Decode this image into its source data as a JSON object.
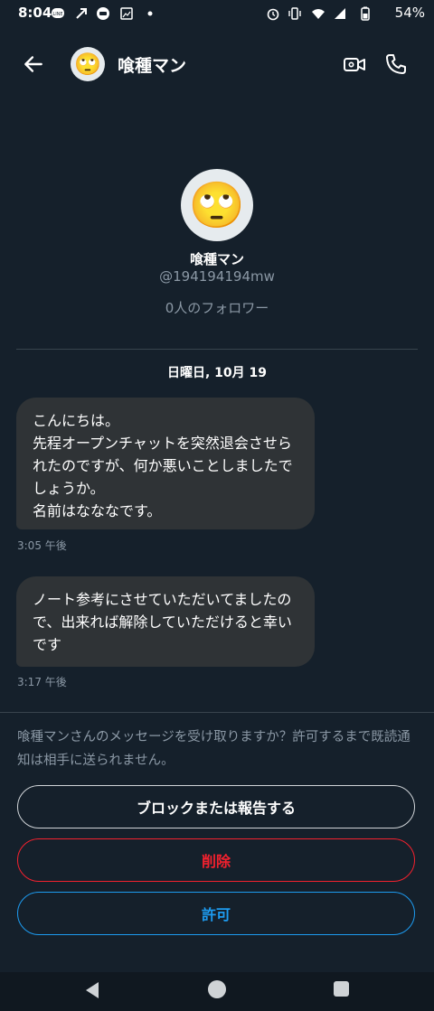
{
  "status_bar": {
    "time": "8:04",
    "battery": "54%",
    "icons": [
      "line-icon",
      "arrow-icon",
      "podcast-icon",
      "gallery-icon",
      "dot-icon",
      "alarm-icon",
      "vibrate-icon",
      "wifi-icon",
      "signal-icon",
      "battery-icon"
    ]
  },
  "header": {
    "name": "喰種マン",
    "avatar_emoji": "🙄"
  },
  "profile": {
    "avatar_emoji": "🙄",
    "name": "喰種マン",
    "handle": "@194194194mw",
    "followers": "0人のフォロワー"
  },
  "conversation": {
    "date": "日曜日, 10月 19",
    "messages": [
      {
        "text": "こんにちは。\n先程オープンチャットを突然退会させられたのですが、何か悪いことしましたでしょうか。\n名前はなななです。",
        "time": "3:05 午後"
      },
      {
        "text": "ノート参考にさせていただいてましたので、出来れば解除していただけると幸いです",
        "time": "3:17 午後"
      }
    ]
  },
  "request": {
    "text": "喰種マンさんのメッセージを受け取りますか？許可するまで既読通知は相手に送られません。",
    "block_label": "ブロックまたは報告する",
    "delete_label": "削除",
    "allow_label": "許可"
  },
  "colors": {
    "background": "#15202b",
    "bubble": "#2f3336",
    "secondary_text": "#8b98a5",
    "danger": "#f4212e",
    "accent": "#1d9bf0"
  }
}
